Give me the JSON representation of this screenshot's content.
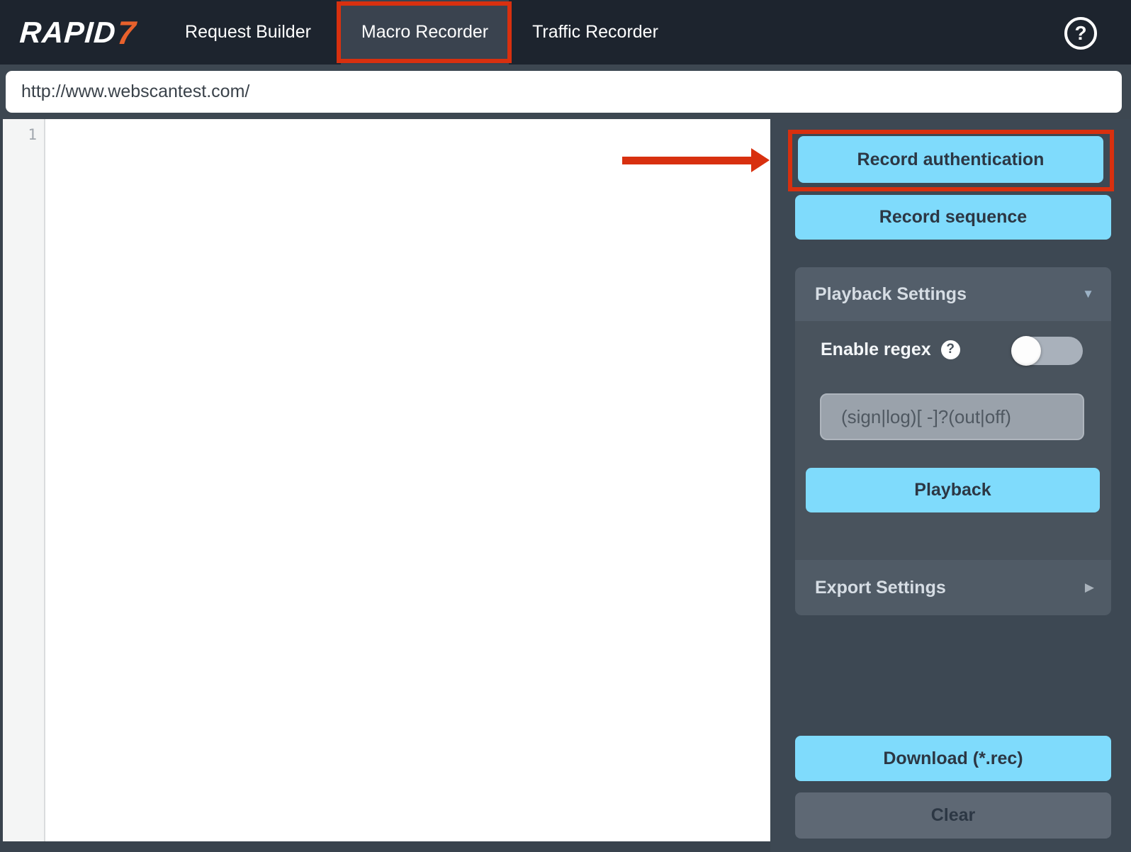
{
  "header": {
    "logo": {
      "text": "RAPID",
      "accent": "7"
    },
    "tabs": [
      {
        "label": "Request Builder",
        "active": false
      },
      {
        "label": "Macro Recorder",
        "active": true
      },
      {
        "label": "Traffic Recorder",
        "active": false
      }
    ],
    "help_icon_glyph": "?"
  },
  "url_bar": {
    "value": "http://www.webscantest.com/"
  },
  "editor": {
    "line_numbers": [
      "1"
    ],
    "content": ""
  },
  "sidebar": {
    "record_auth_label": "Record authentication",
    "record_sequence_label": "Record sequence",
    "playback_settings": {
      "title": "Playback Settings",
      "caret_icon_glyph": "▼",
      "enable_regex_label": "Enable regex",
      "question_icon_glyph": "?",
      "toggle_state": "off",
      "regex_value": "(sign|log)[ -]?(out|off)",
      "playback_label": "Playback"
    },
    "export_settings": {
      "title": "Export Settings",
      "caret_icon_glyph": "▶"
    },
    "download_label": "Download (*.rec)",
    "clear_label": "Clear"
  },
  "annotations": {
    "highlight_color": "#d8300f",
    "highlighted_tab": "Macro Recorder",
    "highlighted_button": "Record authentication"
  },
  "colors": {
    "header_bg": "#1d242e",
    "accent_blue": "#7fdbfc",
    "brand_orange": "#e8612c",
    "sidebar_bg": "#3d4853",
    "panel_header_bg": "#535e6a",
    "panel_body_bg": "#49535d"
  }
}
